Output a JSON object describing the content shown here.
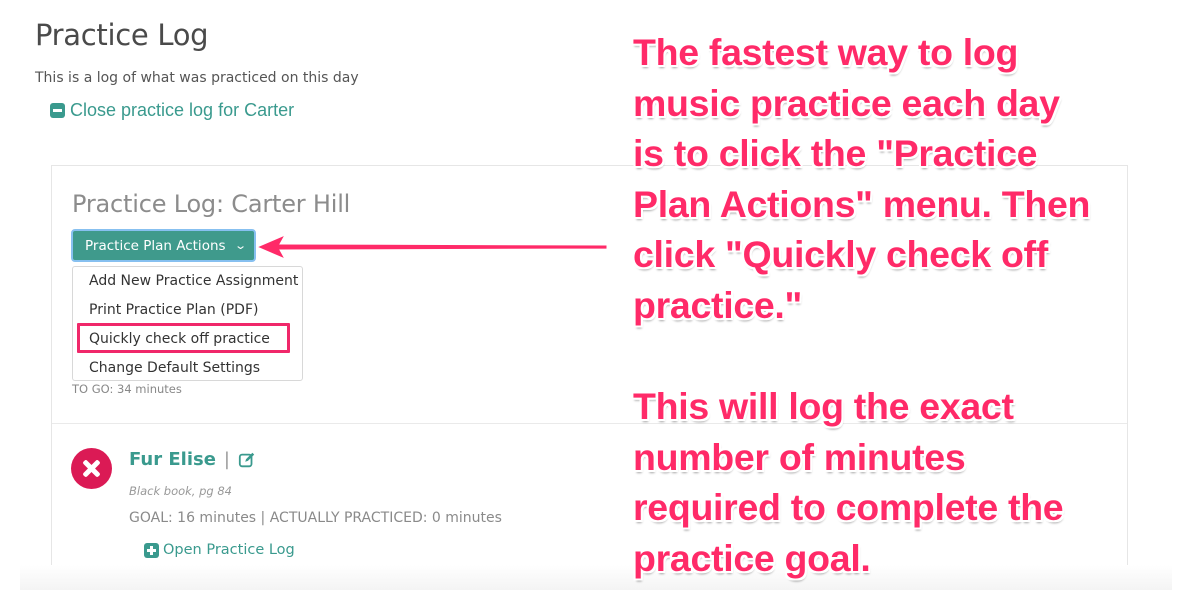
{
  "page": {
    "title": "Practice Log",
    "subtitle": "This is a log of what was practiced on this day",
    "close_link": {
      "icon": "minus-square-icon",
      "label": "Close practice log for Carter"
    }
  },
  "panel": {
    "title": "Practice Log: Carter Hill",
    "actions_button": {
      "label": "Practice Plan Actions",
      "icon": "chevron-down-icon"
    },
    "dropdown": {
      "items": [
        {
          "label": "Add New Practice Assignment"
        },
        {
          "label": "Print Practice Plan (PDF)"
        },
        {
          "label": "Quickly check off practice",
          "highlighted": true
        },
        {
          "label": "Change Default Settings"
        }
      ]
    },
    "to_go": "TO GO: 34 minutes",
    "assignments": [
      {
        "status_icon": "x-circle-icon",
        "title": "Fur Elise",
        "separator": "|",
        "edit_icon": "edit-icon",
        "book": "Black book, pg 84",
        "goal_line": "GOAL: 16 minutes | ACTUALLY PRACTICED: 0 minutes",
        "open_log": {
          "icon": "plus-square-icon",
          "label": "Open Practice Log"
        }
      }
    ]
  },
  "annotations": {
    "callout_1": "The fastest way to log\nmusic practice each day\nis to click the \"Practice\nPlan Actions\" menu. Then\nclick \"Quickly check off\npractice.\"",
    "callout_2": "This will log the exact\nnumber of minutes\nrequired to complete the\npractice goal.",
    "arrow_color": "#ff2a68",
    "highlight_color": "#f0286a"
  },
  "colors": {
    "accent": "#3a9a8e",
    "button": "#3f9a8c",
    "status_red": "#db1a55"
  }
}
